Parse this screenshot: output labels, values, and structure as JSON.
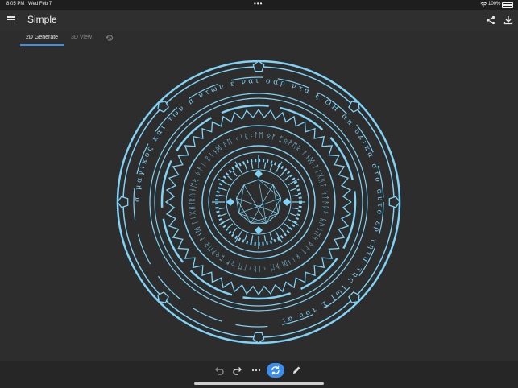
{
  "status_bar": {
    "time": "8:05 PM",
    "date": "Wed Feb 7",
    "dots": "•••",
    "battery": "100%"
  },
  "app_bar": {
    "title": "Simple",
    "icons": [
      "menu-icon",
      "share-icon",
      "download-icon"
    ]
  },
  "tabs": {
    "items": [
      {
        "label": "2D Generate",
        "active": true
      },
      {
        "label": "3D View",
        "active": false
      }
    ],
    "history_icon": "history-icon"
  },
  "magic_circle": {
    "outer_text": "σ μαγικος και των π ντων ε ναι σαρ ντα ξ ΟΗ απ υλικα στο αυτο ερ τητα της [ω] Σ του αι",
    "inner_runes": "ᚱᚢᚾᛖᛋ ᚦᚨᛏ ᛒᛁᚾᛞ ᚦᛖ ᚲᛁᚱᚲᛚᛖ ᛟᚠ ᛈᛟᚹᛖᚱ ᚨᚾᛞ ᛚᛁᚷᚺᛏ ᛋᛏᚨᚱᛋ",
    "color": "#7fd3f7"
  },
  "toolbar": {
    "icons": [
      "undo-icon",
      "redo-icon",
      "more-icon",
      "regenerate-icon",
      "edit-icon"
    ],
    "accent": "#3d8ee8"
  }
}
